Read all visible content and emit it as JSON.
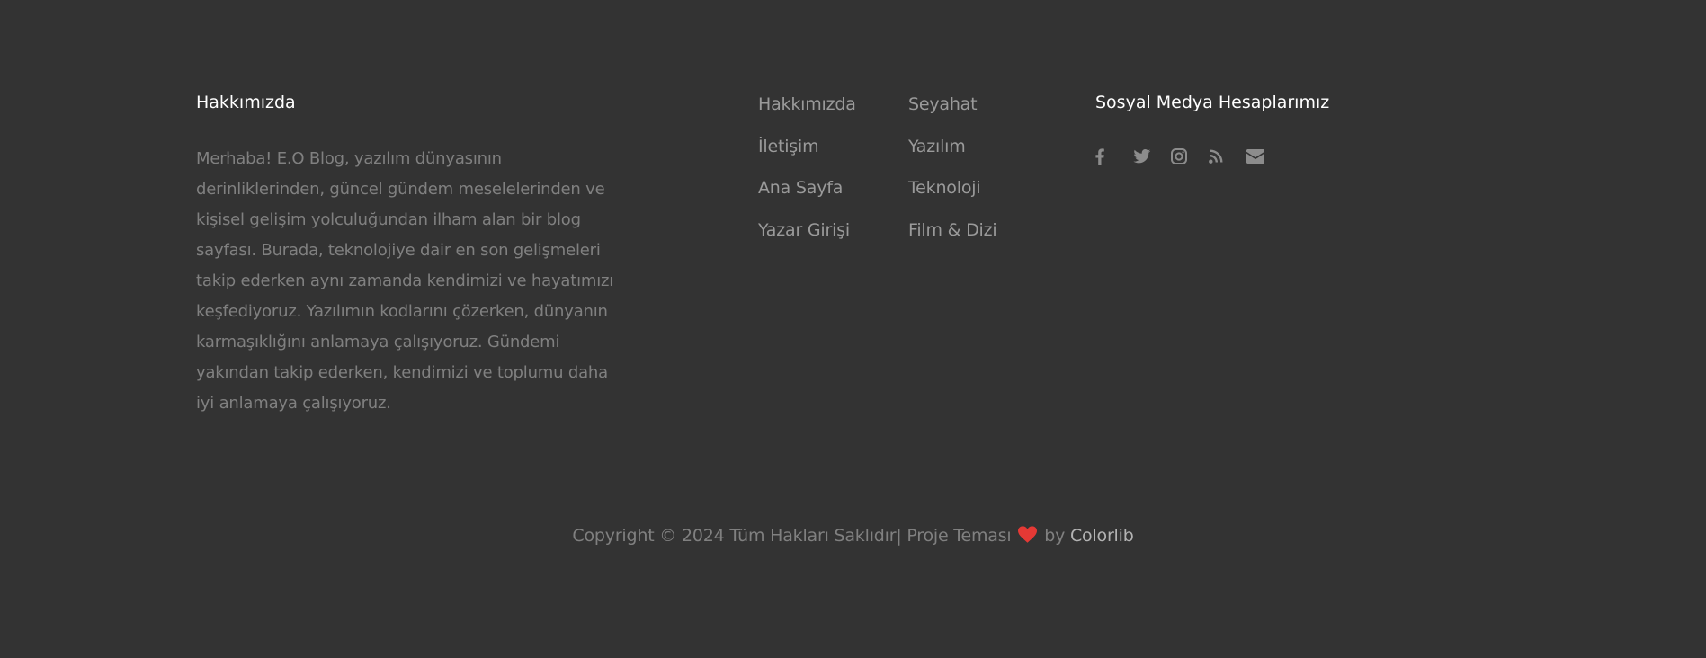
{
  "about": {
    "heading": "Hakkımızda",
    "text": "Merhaba! E.O Blog, yazılım dünyasının derinliklerinden, güncel gündem meselelerinden ve kişisel gelişim yolculuğundan ilham alan bir blog sayfası. Burada, teknolojiye dair en son gelişmeleri takip ederken aynı zamanda kendimizi ve hayatımızı keşfediyoruz. Yazılımın kodlarını çözerken, dünyanın karmaşıklığını anlamaya çalışıyoruz. Gündemi yakından takip ederken, kendimizi ve toplumu daha iyi anlamaya çalışıyoruz."
  },
  "links_col1": [
    {
      "label": "Hakkımızda"
    },
    {
      "label": "İletişim"
    },
    {
      "label": "Ana Sayfa"
    },
    {
      "label": "Yazar Girişi"
    }
  ],
  "links_col2": [
    {
      "label": "Seyahat"
    },
    {
      "label": "Yazılım"
    },
    {
      "label": "Teknoloji"
    },
    {
      "label": "Film & Dizi"
    }
  ],
  "social": {
    "heading": "Sosyal Medya Hesaplarımız",
    "icons": [
      "facebook-icon",
      "twitter-icon",
      "instagram-icon",
      "rss-icon",
      "envelope-icon"
    ],
    "icon_color": "#8c8c8c"
  },
  "copyright": {
    "prefix": "Copyright © 2024 Tüm Hakları Saklıdır| Proje Teması",
    "by": "by",
    "brand": "Colorlib",
    "heart_color": "#e53935"
  },
  "colors": {
    "background": "#333333",
    "heading": "#ffffff",
    "body_text": "#808080",
    "link": "#9a9a9a"
  }
}
